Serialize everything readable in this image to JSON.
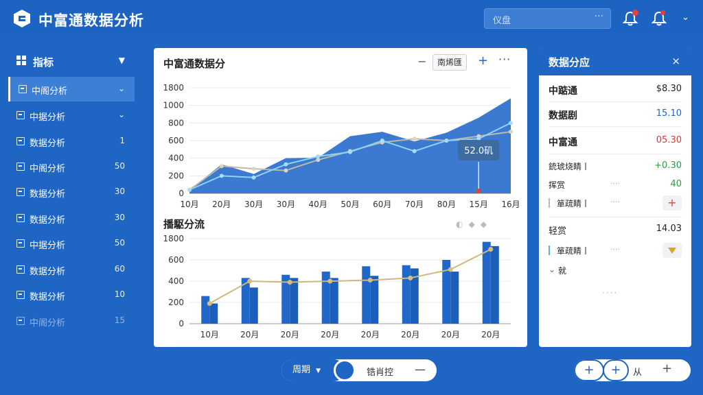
{
  "header": {
    "app_title": "中富通数据分析",
    "search_placeholder": "仪盘",
    "search_more": "···"
  },
  "sidebar": {
    "heading": "指标",
    "items": [
      {
        "label": "中阁分析",
        "value": "⌄"
      },
      {
        "label": "中据分析",
        "value": "⌄"
      },
      {
        "label": "数据分析",
        "value": "1"
      },
      {
        "label": "中阁分析",
        "value": "50"
      },
      {
        "label": "数据分析",
        "value": "30"
      },
      {
        "label": "数据分析",
        "value": "30"
      },
      {
        "label": "中据分析",
        "value": "50"
      },
      {
        "label": "数据分析",
        "value": "60"
      },
      {
        "label": "数据分析",
        "value": "10"
      },
      {
        "label": "中阁分析",
        "value": "15"
      }
    ]
  },
  "main": {
    "chart1_title": "中富通数据分",
    "chart1_filter": "南烯匯",
    "chart2_title": "播駆分流"
  },
  "chart_data": [
    {
      "type": "area",
      "title": "中富通数据分",
      "x": [
        "10月",
        "20月",
        "30月",
        "30月",
        "40月",
        "50月",
        "60月",
        "70月",
        "80月",
        "15月",
        "16月"
      ],
      "y_ticks": [
        0,
        200,
        400,
        600,
        800,
        1000,
        1800
      ],
      "ylim": [
        0,
        1200
      ],
      "series": [
        {
          "values": [
            40,
            330,
            220,
            400,
            405,
            650,
            700,
            590,
            690,
            860,
            1080
          ]
        },
        {
          "values": [
            40,
            310,
            280,
            260,
            380,
            480,
            580,
            620,
            600,
            650,
            700
          ]
        },
        {
          "values": [
            40,
            200,
            180,
            330,
            420,
            470,
            600,
            480,
            600,
            620,
            800
          ]
        }
      ],
      "annotation": {
        "label": "52.0矶",
        "x_index": 9
      }
    },
    {
      "type": "bar",
      "title": "播駆分流",
      "categories": [
        "10月",
        "20月",
        "20月",
        "20月",
        "20月",
        "20月",
        "20月",
        "20月"
      ],
      "y_ticks": [
        0,
        200,
        400,
        600,
        1800
      ],
      "ylim": [
        0,
        800
      ],
      "series": [
        {
          "values": [
            260,
            430,
            460,
            490,
            540,
            550,
            600,
            770
          ]
        },
        {
          "values": [
            190,
            340,
            430,
            430,
            450,
            520,
            490,
            730
          ]
        },
        {
          "values": [
            190,
            400,
            390,
            400,
            410,
            430,
            510,
            700
          ]
        }
      ]
    }
  ],
  "panel": {
    "title": "数据分应",
    "close": "×",
    "rows": [
      {
        "label": "中踮通",
        "value": "$8.30",
        "color": "#222222"
      },
      {
        "label": "数据剧",
        "value": "15.10",
        "color": "#1f66c4"
      },
      {
        "label": "中富通",
        "value": "05.30",
        "color": "#d83a35"
      },
      {
        "label": "銃琥烧睛丨",
        "value": "+0.30",
        "color": "#2c9e3f"
      },
      {
        "label": "挥赏",
        "value": "40",
        "color": "#2c9e3f"
      },
      {
        "label": "箪疏睛丨",
        "value": "+"
      },
      {
        "label": "轻赏",
        "value": "14.03",
        "color": "#222222"
      },
      {
        "label": "箪疏睛丨",
        "value": ""
      },
      {
        "label": "就",
        "value": ""
      }
    ],
    "row_dots": "····",
    "footer_dots": "····"
  },
  "bottom": {
    "period_label": "周期",
    "middle_label": "锆肖控",
    "minus": "—",
    "right_label": "从",
    "plus": "+"
  }
}
